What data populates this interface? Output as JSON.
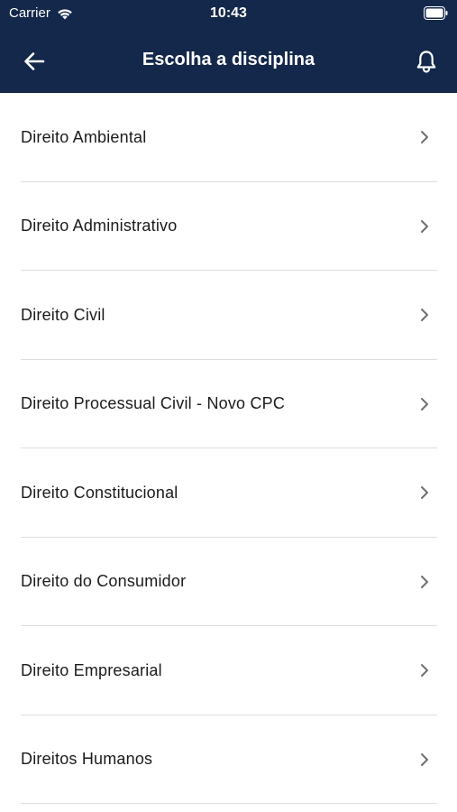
{
  "status_bar": {
    "carrier": "Carrier",
    "time": "10:43"
  },
  "nav": {
    "title": "Escolha a disciplina",
    "back_icon": "arrow-left-icon",
    "right_icon": "bell-icon"
  },
  "subjects": [
    {
      "label": "Direito Ambiental"
    },
    {
      "label": "Direito Administrativo"
    },
    {
      "label": "Direito Civil"
    },
    {
      "label": "Direito Processual Civil - Novo CPC"
    },
    {
      "label": "Direito Constitucional"
    },
    {
      "label": "Direito do Consumidor"
    },
    {
      "label": "Direito Empresarial"
    },
    {
      "label": "Direitos Humanos"
    }
  ],
  "colors": {
    "header_bg": "#14284b",
    "divider": "#dcdde0",
    "chevron": "#6e6e73"
  }
}
